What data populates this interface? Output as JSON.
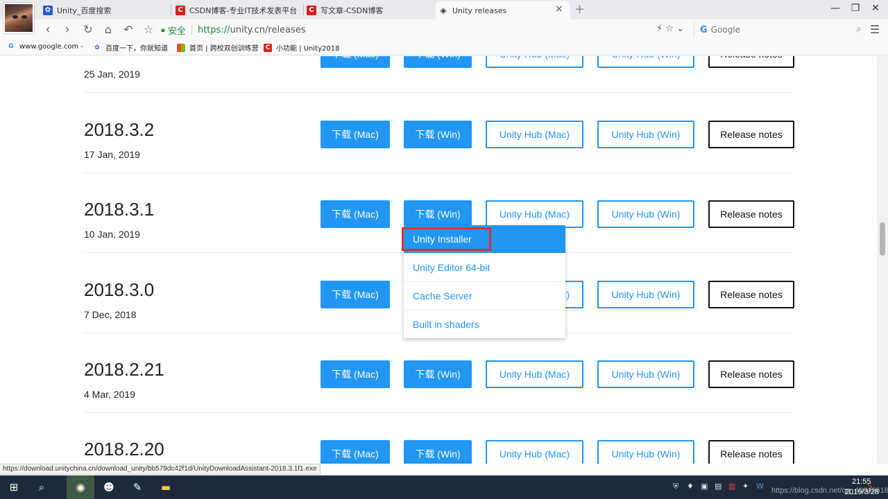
{
  "browser": {
    "tabs": [
      {
        "title": "Unity_百度搜索",
        "icon": "paw-icon",
        "icon_color": "#2a5bd7"
      },
      {
        "title": "CSDN博客-专业IT技术发表平台",
        "icon": "csdn-icon",
        "icon_color": "#d8211b"
      },
      {
        "title": "写文章-CSDN博客",
        "icon": "csdn-icon",
        "icon_color": "#d8211b"
      },
      {
        "title": "Unity releases",
        "icon": "unity-icon",
        "icon_color": "#333333"
      }
    ],
    "address": {
      "secure_label": "安全",
      "url_proto": "https://",
      "url_rest": "unity.cn/releases"
    },
    "search_placeholder": "Google",
    "bookmarks": [
      {
        "label": "www.google.com -",
        "icon_color": "#4285f4"
      },
      {
        "label": "百度一下，你就知道",
        "icon_color": "#2a5bd7"
      },
      {
        "label": "首页 | 跨校双创训练营",
        "icon_color": "#f4a300"
      },
      {
        "label": "小功能 | Unity2018",
        "icon_color": "#d8211b"
      }
    ]
  },
  "releases": [
    {
      "version": "",
      "date": "25 Jan, 2019"
    },
    {
      "version": "2018.3.2",
      "date": "17 Jan, 2019"
    },
    {
      "version": "2018.3.1",
      "date": "10 Jan, 2019"
    },
    {
      "version": "2018.3.0",
      "date": "7 Dec, 2018"
    },
    {
      "version": "2018.2.21",
      "date": "4 Mar, 2019"
    },
    {
      "version": "2018.2.20",
      "date": ""
    }
  ],
  "buttons": {
    "download_mac": "下载 (Mac)",
    "download_win": "下载 (Win)",
    "hub_mac": "Unity Hub (Mac)",
    "hub_win": "Unity Hub (Win)",
    "release_notes": "Release notes"
  },
  "dropdown": {
    "items": [
      "Unity Installer",
      "Unity Editor 64-bit",
      "Cache Server",
      "Built in shaders"
    ],
    "highlight_color": "#e03030"
  },
  "status_url": "https://download.unitychina.cn/download_unity/bb579dc42f1d/UnityDownloadAssistant-2018.3.1f1.exe",
  "taskbar": {
    "time": "21:55",
    "date": "2019/3/28",
    "watermark": "https://blog.csdn.net/qq_40948616"
  },
  "colors": {
    "accent": "#2196f3",
    "text": "#222222"
  }
}
